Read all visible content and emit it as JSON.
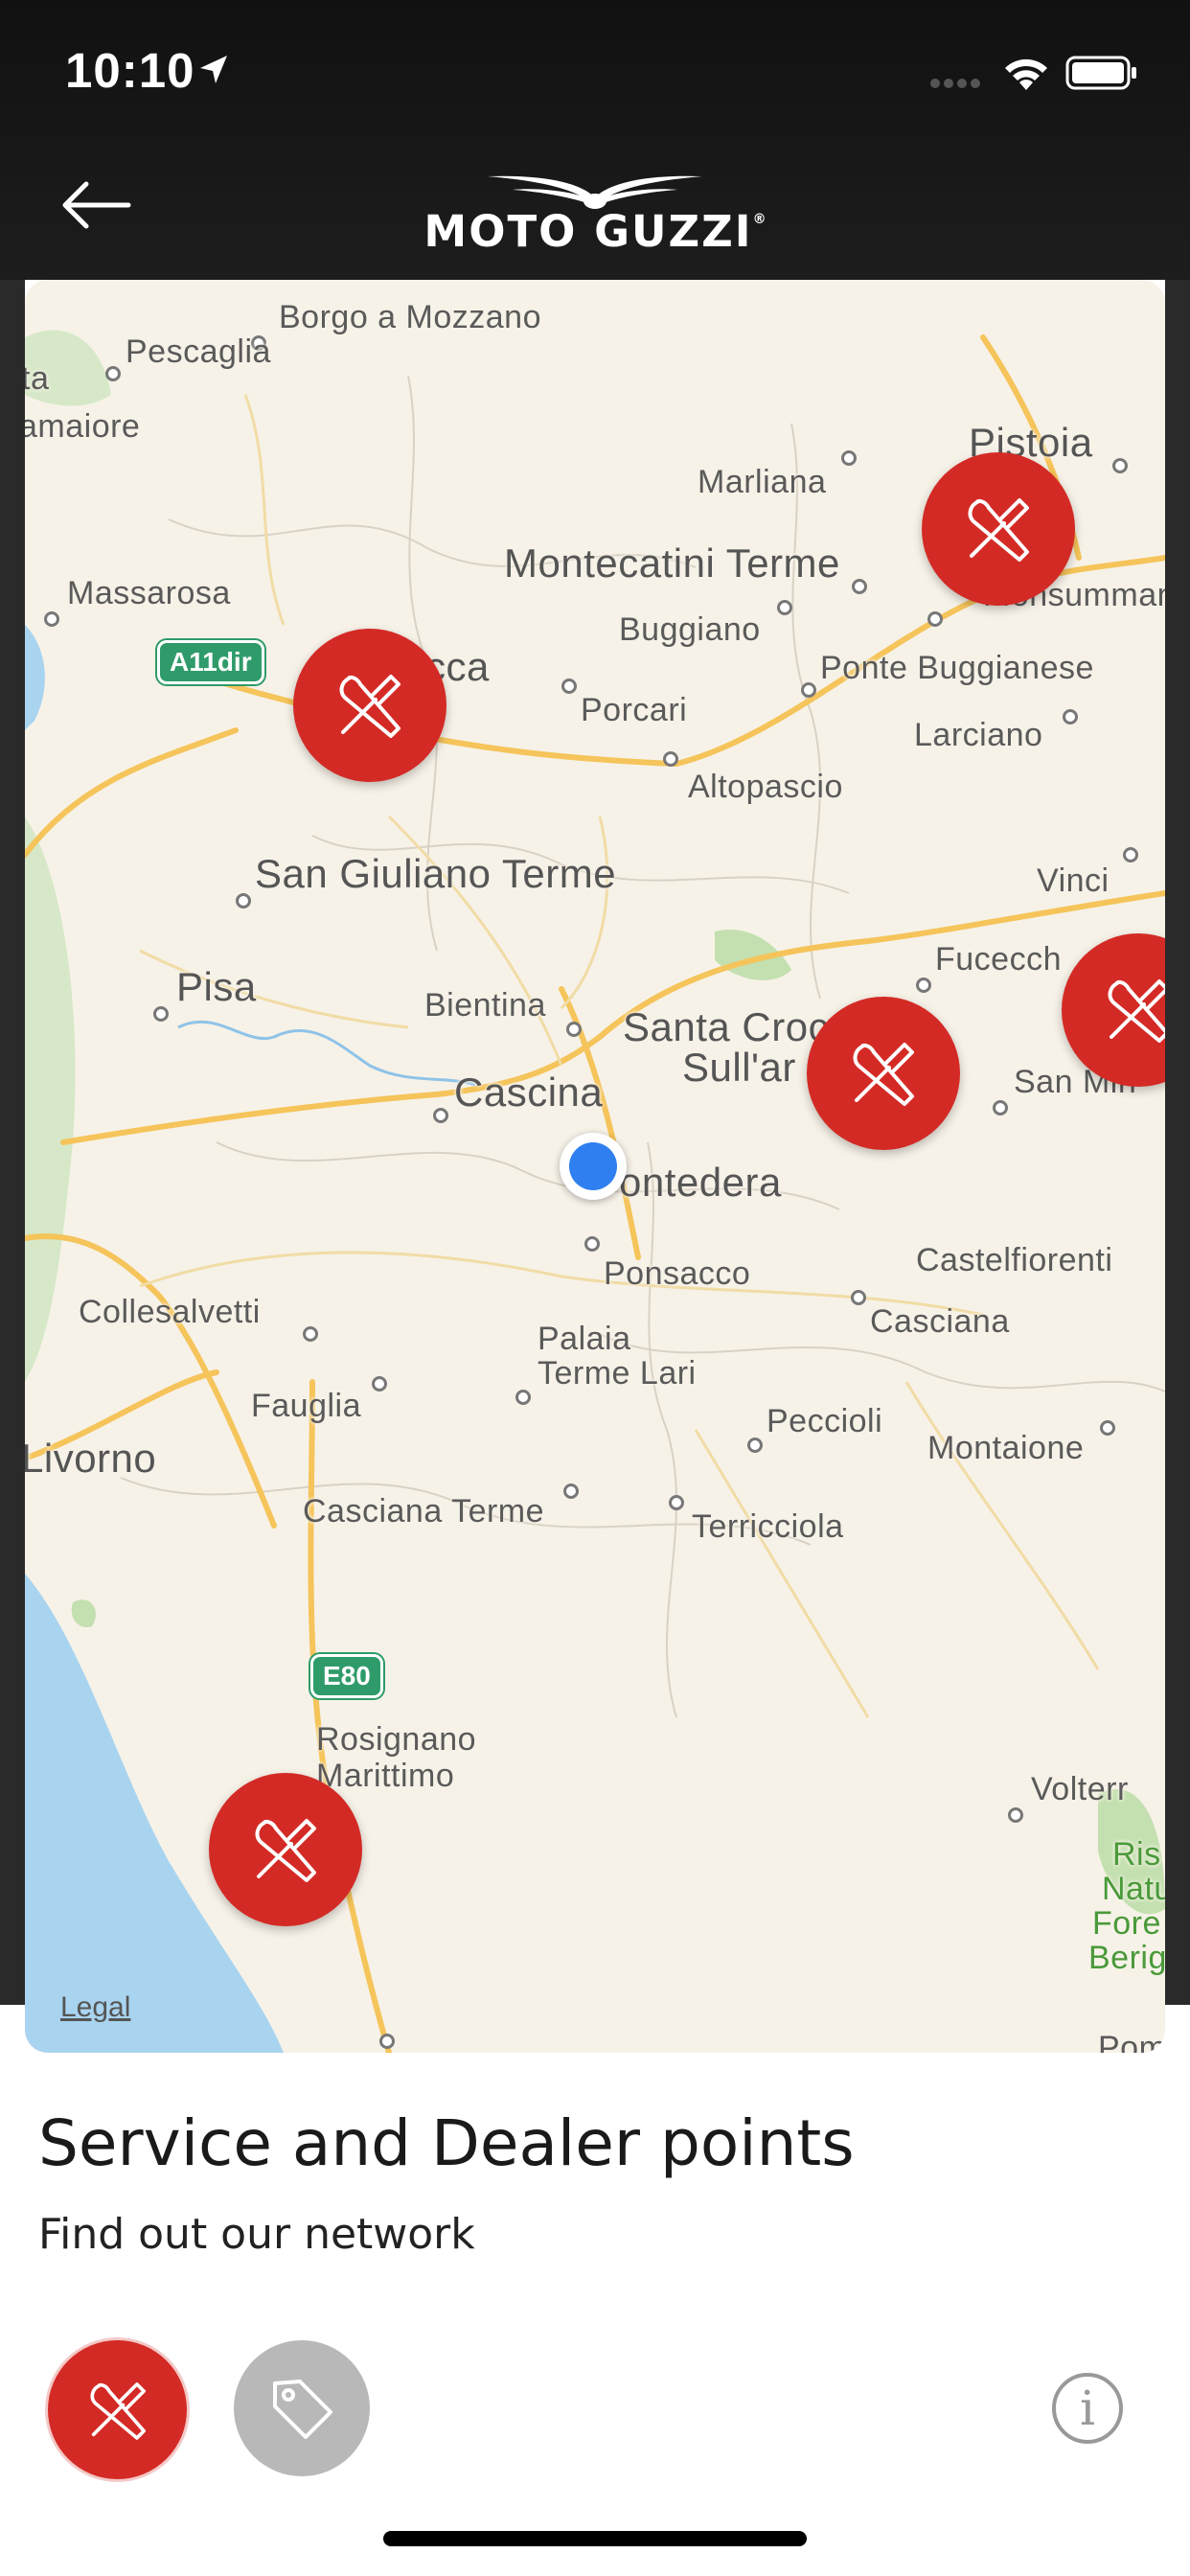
{
  "status_bar": {
    "time": "10:10"
  },
  "header": {
    "brand": "MOTO GUZZI",
    "brand_mark": "®"
  },
  "map": {
    "legal": "Legal",
    "places": [
      "Borgo a Mozzano",
      "Pescaglia",
      "ta",
      "amaiore",
      "Pistoia",
      "Marliana",
      "Montecatini Terme",
      "Monsumman",
      "Massarosa",
      "Buggiano",
      "cca",
      "Porcari",
      "Ponte Buggianese",
      "Larciano",
      "Altopascio",
      "San Giuliano Terme",
      "Vinci",
      "Fucecch",
      "Pisa",
      "Bientina",
      "Santa Croc",
      "Sull'ar",
      "San Min",
      "Cascina",
      "ontedera",
      "Ponsacco",
      "Castelfiorenti",
      "Collesalvetti",
      "Palaia",
      "Casciana",
      "Terme Lari",
      "Fauglia",
      "Peccioli",
      "Montaione",
      "Livorno",
      "Casciana Terme",
      "Terricciola",
      "Rosignano",
      "Marittimo",
      "Volterr",
      "Ris",
      "Natu",
      "Fore",
      "Berig",
      "Pomar"
    ],
    "road_shields": [
      "A11dir",
      "E80"
    ]
  },
  "sheet": {
    "title": "Service and Dealer points",
    "subtitle": "Find out our network"
  },
  "filters": {
    "service_icon": "tools-icon",
    "dealer_icon": "tag-icon",
    "info_label": "i"
  },
  "colors": {
    "accent": "#d42a25",
    "user_location": "#2f7ff0",
    "inactive_filter": "#b8b8b8"
  }
}
